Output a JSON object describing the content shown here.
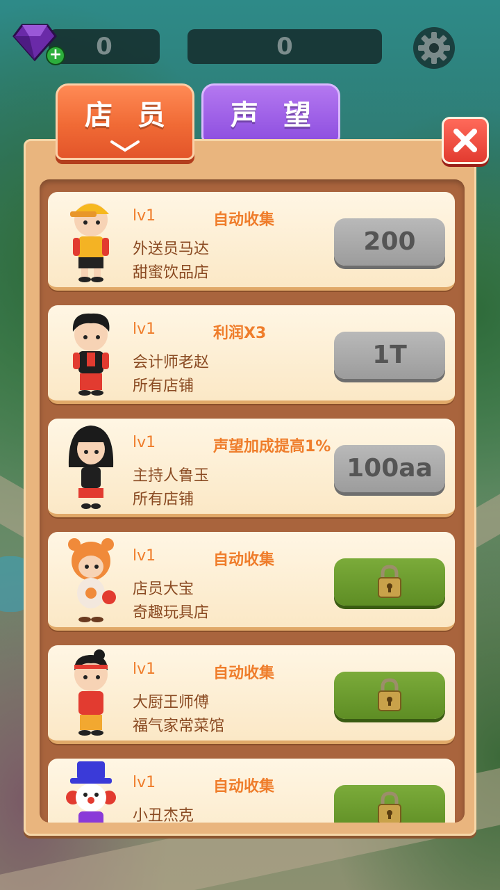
{
  "header": {
    "gems": "0",
    "coins": "0"
  },
  "tabs": [
    {
      "label": "店员",
      "active": true
    },
    {
      "label": "声望",
      "active": false
    }
  ],
  "staff": [
    {
      "level": "lv1",
      "skill": "自动收集",
      "name": "外送员马达",
      "shop": "甜蜜饮品店",
      "price": "200",
      "locked": false
    },
    {
      "level": "lv1",
      "skill": "利润X3",
      "name": "会计师老赵",
      "shop": "所有店铺",
      "price": "1T",
      "locked": false
    },
    {
      "level": "lv1",
      "skill": "声望加成提高1%",
      "name": "主持人鲁玉",
      "shop": "所有店铺",
      "price": "100aa",
      "locked": false
    },
    {
      "level": "lv1",
      "skill": "自动收集",
      "name": "店员大宝",
      "shop": "奇趣玩具店",
      "price": "",
      "locked": true
    },
    {
      "level": "lv1",
      "skill": "自动收集",
      "name": "大厨王师傅",
      "shop": "福气家常菜馆",
      "price": "",
      "locked": true
    },
    {
      "level": "lv1",
      "skill": "自动收集",
      "name": "小丑杰克",
      "shop": "",
      "price": "",
      "locked": true
    }
  ],
  "colors": {
    "accent_orange": "#f06a35",
    "tab_purple": "#8e4fe0",
    "lock_green": "#6a9a2c",
    "price_gray": "#a8a8a8"
  }
}
